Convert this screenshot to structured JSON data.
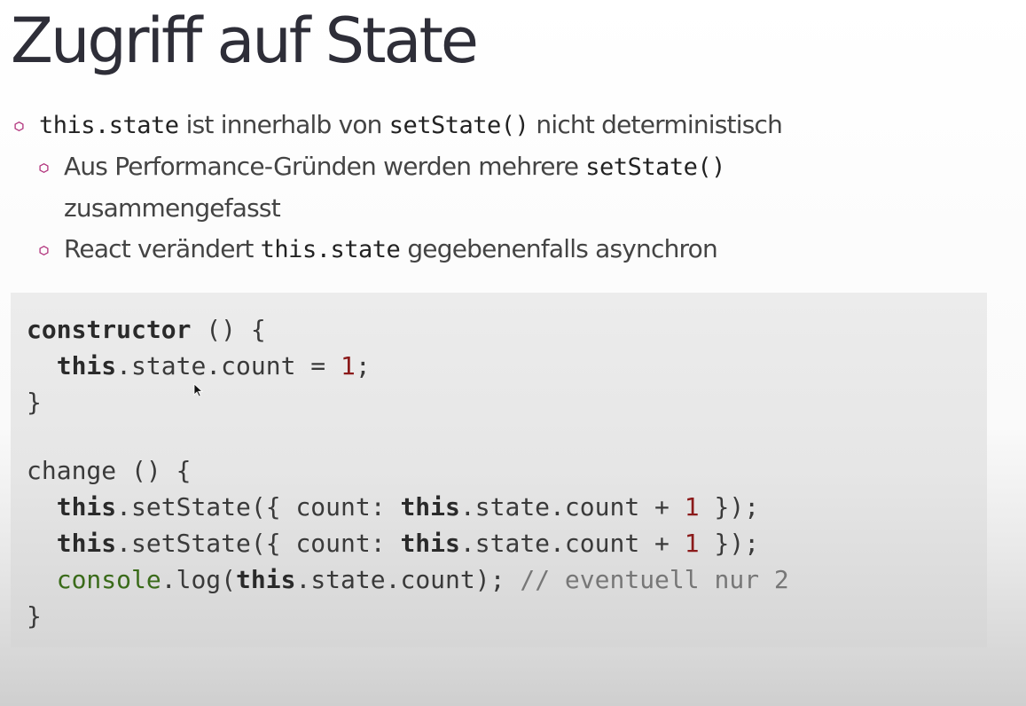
{
  "title": "Zugriff auf State",
  "bullets": {
    "b1": {
      "code1": "this.state",
      "text1": " ist innerhalb von ",
      "code2": "setState()",
      "text2": " nicht deterministisch"
    },
    "b2": {
      "text1": "Aus Performance-Gründen werden mehrere ",
      "code1": "setState()",
      "text2": "zusammengefasst"
    },
    "b3": {
      "text1": "React verändert ",
      "code1": "this.state",
      "text2": " gegebenenfalls asynchron"
    }
  },
  "code": {
    "l1": {
      "kw": "constructor",
      "rest": " () {"
    },
    "l2": {
      "indent": "  ",
      "kw": "this",
      "rest": ".state.count = ",
      "num": "1",
      "end": ";"
    },
    "l3": {
      "text": "}"
    },
    "l5": {
      "text": "change () {"
    },
    "l6": {
      "indent": "  ",
      "kw1": "this",
      "mid1": ".setState({ count: ",
      "kw2": "this",
      "mid2": ".state.count + ",
      "num": "1",
      "end": " });"
    },
    "l7": {
      "indent": "  ",
      "kw1": "this",
      "mid1": ".setState({ count: ",
      "kw2": "this",
      "mid2": ".state.count + ",
      "num": "1",
      "end": " });"
    },
    "l8": {
      "indent": "  ",
      "fn": "console",
      "mid1": ".log(",
      "kw": "this",
      "mid2": ".state.count); ",
      "comment": "// eventuell nur 2"
    },
    "l9": {
      "text": "}"
    }
  },
  "icons": {
    "bullet": "hexagon-outline-icon",
    "bullet_color": "#b0307a",
    "cursor": "mouse-pointer-icon"
  }
}
